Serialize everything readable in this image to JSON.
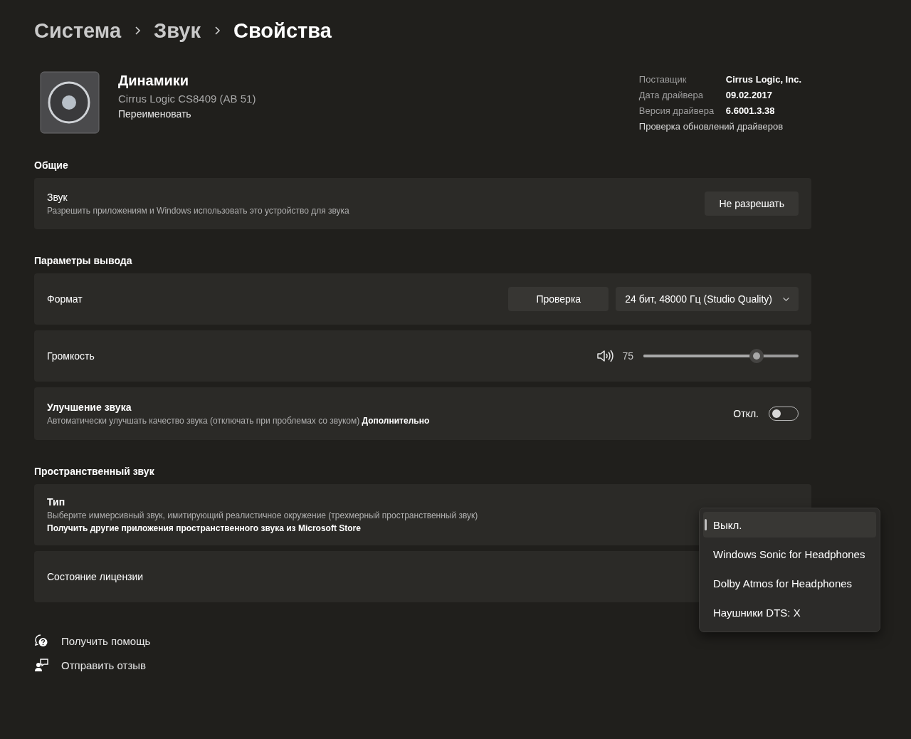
{
  "breadcrumb": [
    {
      "label": "Система",
      "current": false
    },
    {
      "label": "Звук",
      "current": false
    },
    {
      "label": "Свойства",
      "current": true
    }
  ],
  "device": {
    "name": "Динамики",
    "model": "Cirrus Logic CS8409 (AB 51)",
    "rename": "Переименовать"
  },
  "driver_info": [
    {
      "label": "Поставщик",
      "value": "Cirrus Logic, Inc."
    },
    {
      "label": "Дата драйвера",
      "value": "09.02.2017"
    },
    {
      "label": "Версия драйвера",
      "value": "6.6001.3.38"
    }
  ],
  "driver_update_link": "Проверка обновлений драйверов",
  "sections": [
    {
      "heading": "Общие",
      "rows": [
        {
          "kind": "button",
          "title": "Звук",
          "description": "Разрешить приложениям и Windows использовать это устройство для звука",
          "button": "Не разрешать"
        }
      ]
    },
    {
      "heading": "Параметры вывода",
      "rows": [
        {
          "kind": "format",
          "title": "Формат",
          "button": "Проверка",
          "dropdown": "24 бит, 48000 Гц (Studio Quality)"
        },
        {
          "kind": "slider",
          "title": "Громкость",
          "reading": "75",
          "level": 0.73
        },
        {
          "kind": "toggle",
          "title": "Улучшение звука",
          "description": "Автоматически улучшать качество звука (отключать при проблемах со звуком)",
          "link": "Дополнительно",
          "state_label": "Откл.",
          "on": false
        }
      ]
    },
    {
      "heading": "Пространственный звук",
      "rows": [
        {
          "kind": "type",
          "title": "Тип",
          "description": "Выберите иммерсивный звук, имитирующий реалистичное окружение (трехмерный пространственный звук)",
          "link": "Получить другие приложения пространственного звука из Microsoft Store"
        },
        {
          "kind": "plain",
          "title": "Состояние лицензии"
        }
      ]
    }
  ],
  "menu": [
    {
      "label": "Выкл.",
      "selected": true
    },
    {
      "label": "Windows Sonic for Headphones",
      "selected": false
    },
    {
      "label": "Dolby Atmos for Headphones",
      "selected": false
    },
    {
      "label": "Наушники DTS: X",
      "selected": false
    }
  ],
  "footer_links": [
    {
      "kind": "help",
      "label": "Получить помощь"
    },
    {
      "kind": "feedback",
      "label": "Отправить отзыв"
    }
  ]
}
